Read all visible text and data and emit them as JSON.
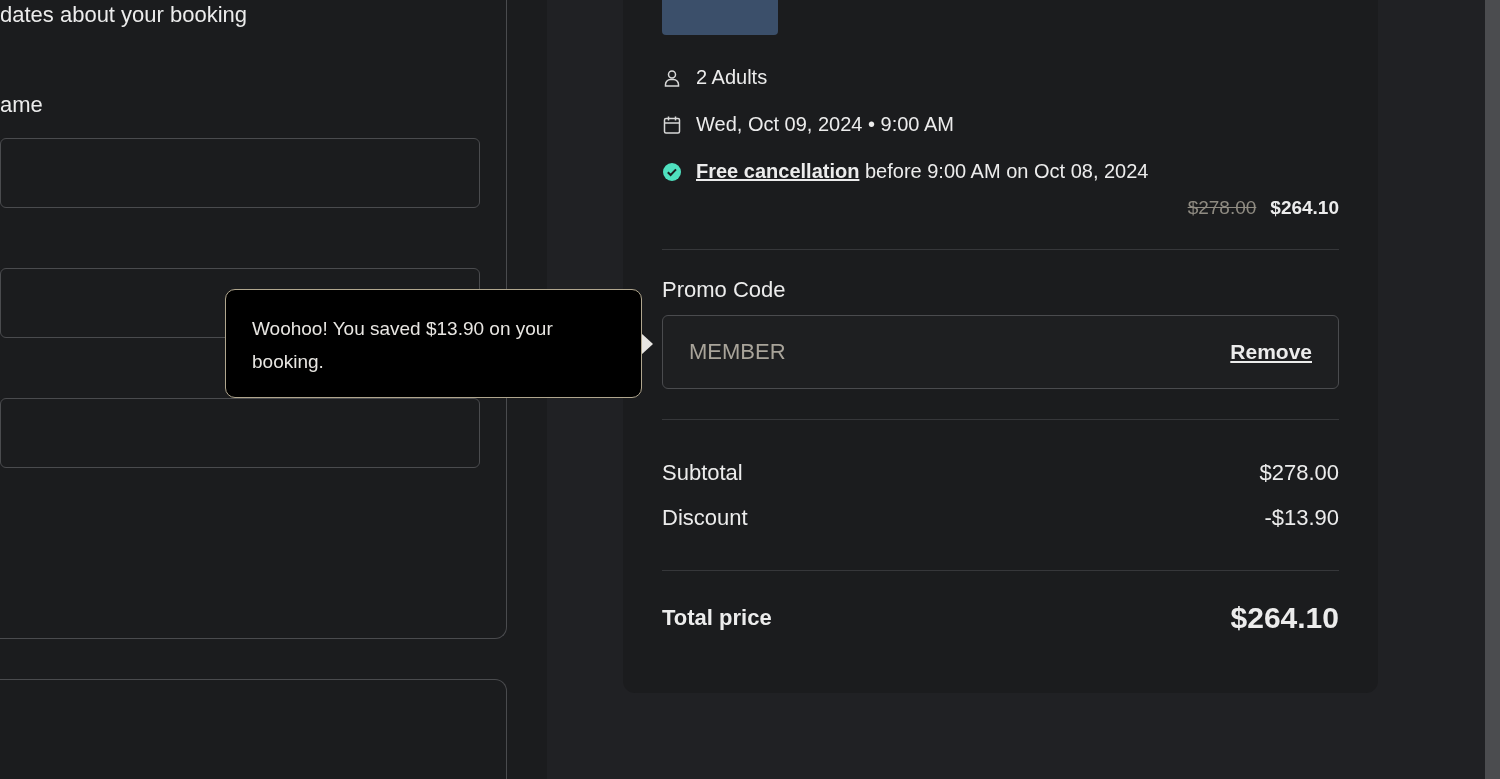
{
  "contact_form": {
    "subtitle": "dates about your booking",
    "field_label": "ame"
  },
  "summary": {
    "details": [
      {
        "kind": "travelers",
        "text": "2 Adults"
      },
      {
        "kind": "date",
        "text": "Wed, Oct 09, 2024 • 9:00 AM"
      },
      {
        "kind": "cancellation",
        "link": "Free cancellation",
        "text": "before 9:00 AM on Oct 08, 2024"
      }
    ],
    "original_price": "$278.00",
    "price": "$264.10",
    "promo": {
      "label": "Promo Code",
      "value": "MEMBER",
      "action": "Remove"
    },
    "lines": [
      {
        "label": "Subtotal",
        "value": "$278.00"
      },
      {
        "label": "Discount",
        "value": "-$13.90"
      }
    ],
    "total": {
      "label": "Total price",
      "value": "$264.10"
    }
  },
  "tooltip": {
    "text": "Woohoo! You saved $13.90 on your booking."
  }
}
